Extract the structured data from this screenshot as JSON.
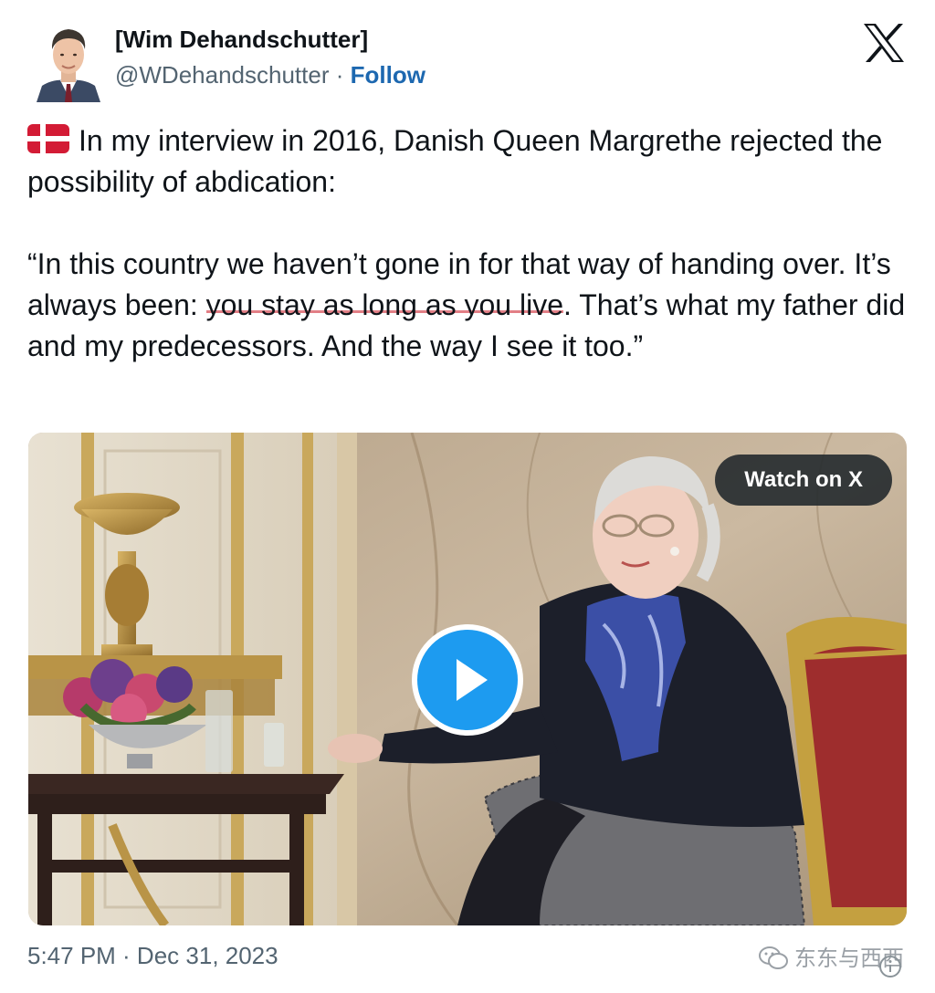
{
  "author": {
    "display_name": "[Wim Dehandschutter]",
    "handle": "@WDehandschutter",
    "separator": "·",
    "follow_label": "Follow"
  },
  "brand": {
    "logo_icon": "x-logo-icon"
  },
  "tweet": {
    "flag_icon": "denmark-flag-icon",
    "para1": "In my interview in 2016, Danish Queen Margrethe rejected the possibility of abdication:",
    "quote_start": "“In this country we haven’t gone in for that way of handing over. It’s always been: ",
    "quote_highlight": "you stay as long as you live",
    "quote_end": ". That’s what my father did and my predecessors. And the way I see it too.”"
  },
  "media": {
    "watch_label": "Watch on X",
    "play_icon": "play-icon"
  },
  "footer": {
    "timestamp": "5:47 PM · Dec 31, 2023",
    "watermark": "东东与西西",
    "watermark_icon": "wechat-icon",
    "info_icon": "info-icon"
  },
  "colors": {
    "follow": "#1d68b0",
    "play": "#1d9bf0",
    "highlight_underline": "#e27f86",
    "secondary_text": "#536471"
  }
}
